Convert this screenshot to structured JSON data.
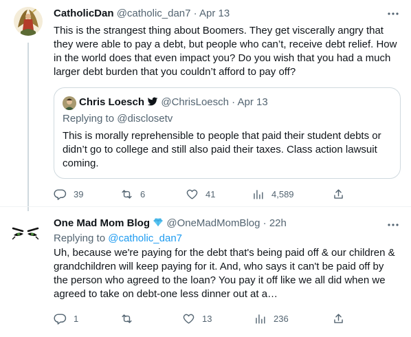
{
  "tweet1": {
    "name": "CatholicDan",
    "handle": "@catholic_dan7",
    "separator": "·",
    "time": "Apr 13",
    "text": "This is the strangest thing about Boomers. They get viscerally angry that they were able to pay a debt, but people who can’t, receive debt relief. How in the world does that even impact you? Do you wish that you had a much larger debt burden that you couldn’t afford to pay off?",
    "quote": {
      "name": "Chris Loesch",
      "handle": "@ChrisLoesch",
      "separator": "·",
      "time": "Apr 13",
      "replying_prefix": "Replying to",
      "replying_to": "@disclosetv",
      "text": "This is morally reprehensible to people that paid their student debts or didn’t go to college and still also paid their taxes. Class action lawsuit coming."
    },
    "actions": {
      "replies": "39",
      "retweets": "6",
      "likes": "41",
      "views": "4,589"
    }
  },
  "tweet2": {
    "name": "One Mad Mom Blog",
    "handle": "@OneMadMomBlog",
    "separator": "·",
    "time": "22h",
    "replying_prefix": "Replying to",
    "replying_to": "@catholic_dan7",
    "text": "Uh, because we're paying for the debt that's being paid off & our children &  grandchildren will keep paying for it. And, who says it can't be paid off by the person who agreed to the loan? You pay it off like we all did when we agreed to take on debt-one less dinner out at a…",
    "actions": {
      "replies": "1",
      "retweets": "",
      "likes": "13",
      "views": "236"
    }
  },
  "colors": {
    "text": "#0f1419",
    "secondary": "#536471",
    "link": "#1d9bf0",
    "border": "#cfd9de"
  }
}
